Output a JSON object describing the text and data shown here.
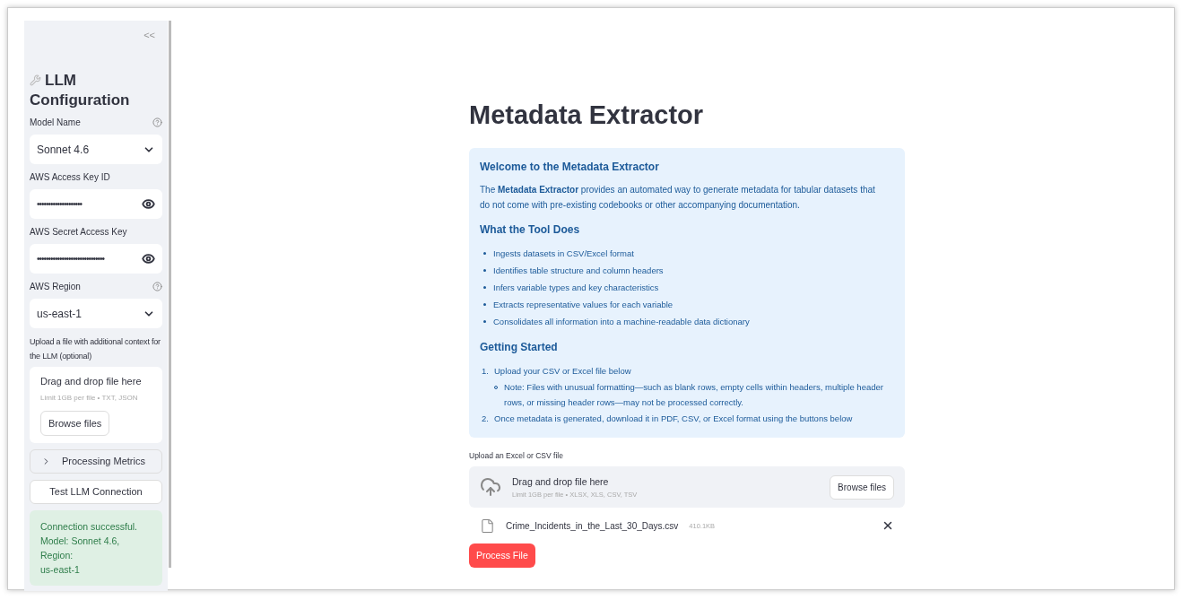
{
  "sidebar": {
    "collapse_glyph": "<<",
    "title_line1": "LLM",
    "title_line2": "Configuration",
    "fields": [
      {
        "kind": "select",
        "label": "Model Name",
        "help": true,
        "value": "Sonnet 4.6"
      },
      {
        "kind": "password",
        "label": "AWS Access Key ID",
        "help": false,
        "value": "••••••••••••••••••••"
      },
      {
        "kind": "password",
        "label": "AWS Secret Access Key",
        "help": false,
        "value": "••••••••••••••••••••••••••••••"
      },
      {
        "kind": "select",
        "label": "AWS Region",
        "help": true,
        "value": "us-east-1"
      }
    ],
    "uploader": {
      "label": "Upload a file with additional context for the LLM (optional)",
      "drop_text": "Drag and drop file here",
      "limit": "Limit 1GB per file • TXT, JSON",
      "button": "Browse files"
    },
    "expander": {
      "label": "Processing Metrics",
      "expanded": false
    },
    "test_button": "Test LLM Connection",
    "success_lines": [
      "Connection successful.",
      "Model: Sonnet 4.6, Region:",
      "us-east-1"
    ]
  },
  "main": {
    "title": "Metadata Extractor",
    "info": {
      "heading": "Welcome to the Metadata Extractor",
      "intro": "The **Metadata Extractor** provides an automated way to generate metadata for tabular datasets that do not come with pre-existing codebooks or other accompanying documentation.",
      "features_heading": "What the Tool Does",
      "features": [
        "Ingests datasets in CSV/Excel format",
        "Identifies table structure and column headers",
        "Infers variable types and key characteristics",
        "Extracts representative values for each variable",
        "Consolidates all information into a machine-readable data dictionary"
      ],
      "start_heading": "Getting Started",
      "steps": [
        {
          "number": "1.",
          "text": "Upload your CSV or Excel file below",
          "notes": [
            "Note: Files with unusual formatting—such as blank rows, empty cells within headers, multiple header rows, or missing header rows—may not be processed correctly."
          ]
        },
        {
          "number": "2.",
          "text": "Once metadata is generated, download it in PDF, CSV, or Excel format using the buttons below"
        }
      ]
    },
    "uploader": {
      "label": "Upload an Excel or CSV file",
      "drop_text": "Drag and drop file here",
      "limit": "Limit 1GB per file • XLSX, XLS, CSV, TSV",
      "button": "Browse files"
    },
    "file": {
      "name": "Crime_Incidents_in_the_Last_30_Days.csv",
      "size": "410.1KB"
    },
    "process_button": "Process File"
  }
}
